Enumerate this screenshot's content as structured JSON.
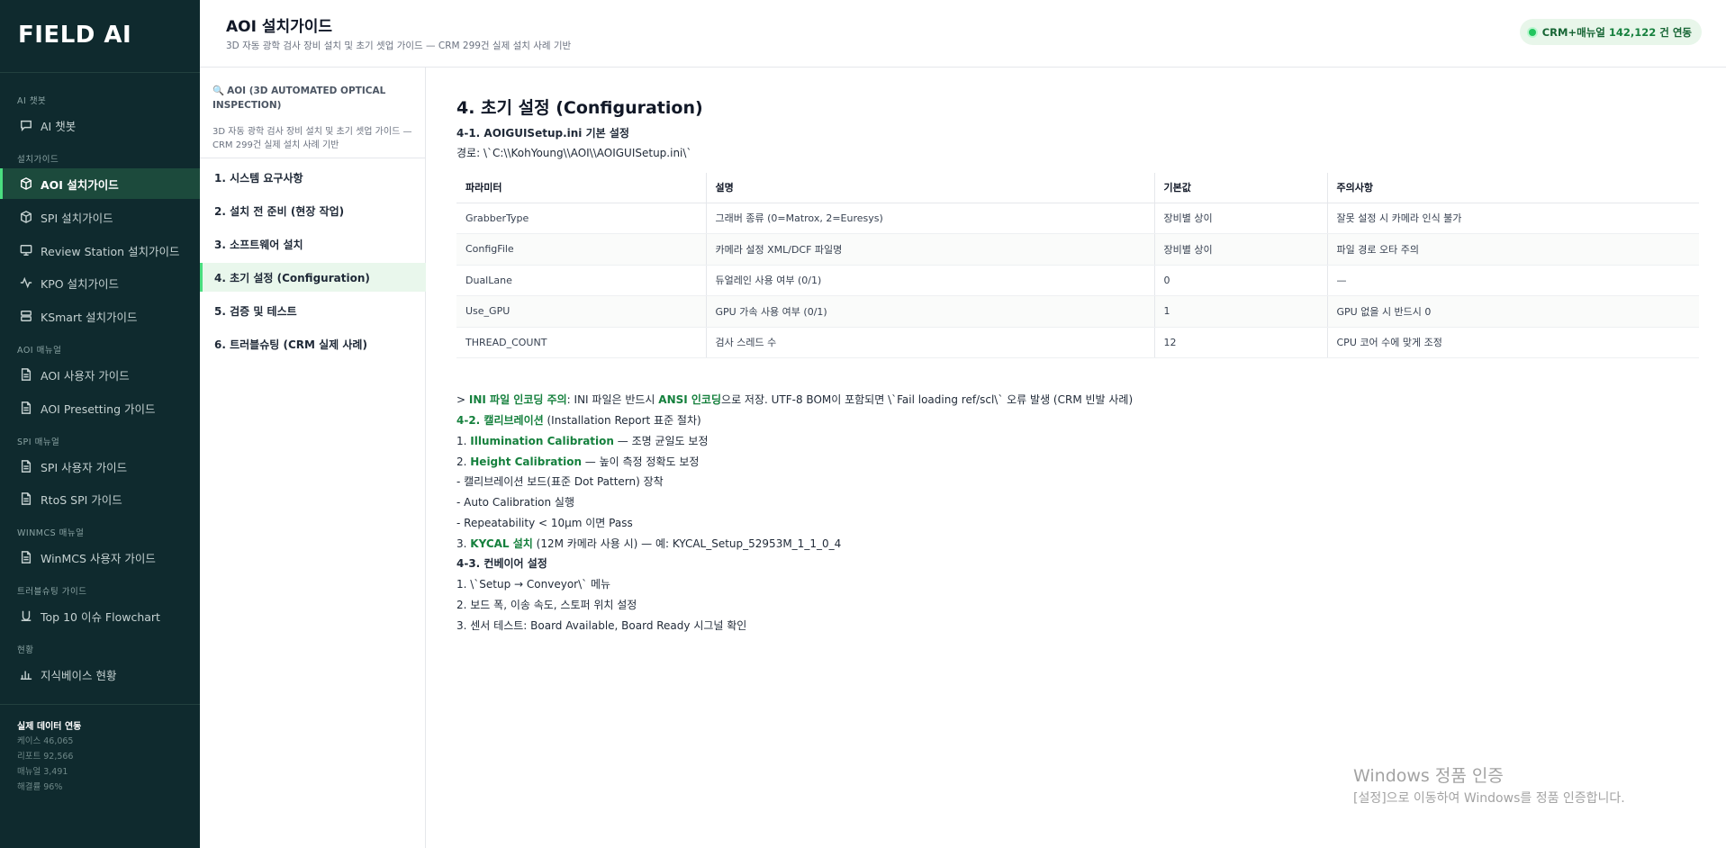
{
  "app": {
    "logo": "FIELD AI"
  },
  "sidebar": {
    "sections": [
      {
        "title": "AI 챗봇",
        "items": [
          {
            "label": "AI 챗봇",
            "icon": "chat-icon"
          }
        ]
      },
      {
        "title": "설치가이드",
        "items": [
          {
            "label": "AOI 설치가이드",
            "icon": "box-icon",
            "active": true
          },
          {
            "label": "SPI 설치가이드",
            "icon": "box-icon"
          },
          {
            "label": "Review Station 설치가이드",
            "icon": "monitor-icon"
          },
          {
            "label": "KPO 설치가이드",
            "icon": "pulse-icon"
          },
          {
            "label": "KSmart 설치가이드",
            "icon": "server-icon"
          }
        ]
      },
      {
        "title": "AOI 매뉴얼",
        "items": [
          {
            "label": "AOI 사용자 가이드",
            "icon": "document-icon"
          },
          {
            "label": "AOI Presetting 가이드",
            "icon": "document-icon"
          }
        ]
      },
      {
        "title": "SPI 매뉴얼",
        "items": [
          {
            "label": "SPI 사용자 가이드",
            "icon": "document-icon"
          },
          {
            "label": "RtoS SPI 가이드",
            "icon": "document-icon"
          }
        ]
      },
      {
        "title": "WINMCS 매뉴얼",
        "items": [
          {
            "label": "WinMCS 사용자 가이드",
            "icon": "document-icon"
          }
        ]
      },
      {
        "title": "트러블슈팅 가이드",
        "items": [
          {
            "label": "Top 10 이슈 Flowchart",
            "icon": "flow-icon"
          }
        ]
      },
      {
        "title": "현황",
        "items": [
          {
            "label": "지식베이스 현황",
            "icon": "bar-chart-icon"
          }
        ]
      }
    ],
    "footer": {
      "title": "실제 데이터 연동",
      "stats": [
        "케이스 46,065",
        "리포트 92,566",
        "매뉴얼 3,491",
        "해결률 96%"
      ]
    }
  },
  "header": {
    "title": "AOI 설치가이드",
    "subtitle": "3D 자동 광학 검사 장비 설치 및 초기 셋업 가이드 — CRM 299건 실제 설치 사례 기반",
    "sync": {
      "prefix": "CRM+매뉴얼",
      "count": "142,122",
      "suffix": "건 연동",
      "accent": "#22c55e"
    }
  },
  "guide": {
    "title": "AOI (3D AUTOMATED OPTICAL INSPECTION)",
    "description": "3D 자동 광학 검사 장비 설치 및 초기 셋업 가이드 — CRM 299건 실제 설치 사례 기반",
    "items": [
      "1. 시스템 요구사항",
      "2. 설치 전 준비 (현장 작업)",
      "3. 소프트웨어 설치",
      "4. 초기 설정 (Configuration)",
      "5. 검증 및 테스트",
      "6. 트러블슈팅 (CRM 실제 사례)"
    ],
    "active_index": 3
  },
  "content": {
    "title": "4. 초기 설정 (Configuration)",
    "s1_title": "4-1. AOIGUISetup.ini 기본 설정",
    "s1_path": "경로: \\`C:\\\\KohYoung\\\\AOI\\\\AOIGUISetup.ini\\`",
    "table": {
      "headers": [
        "파라미터",
        "설명",
        "기본값",
        "주의사항"
      ],
      "rows": [
        [
          "GrabberType",
          "그래버 종류 (0=Matrox, 2=Euresys)",
          "장비별 상이",
          "잘못 설정 시 카메라 인식 불가"
        ],
        [
          "ConfigFile",
          "카메라 설정 XML/DCF 파일명",
          "장비별 상이",
          "파일 경로 오타 주의"
        ],
        [
          "DualLane",
          "듀얼레인 사용 여부 (0/1)",
          "0",
          "—"
        ],
        [
          "Use_GPU",
          "GPU 가속 사용 여부 (0/1)",
          "1",
          "GPU 없을 시 반드시 0"
        ],
        [
          "THREAD_COUNT",
          "검사 스레드 수",
          "12",
          "CPU 코어 수에 맞게 조정"
        ]
      ]
    },
    "note": {
      "prefix": "> ",
      "label": "INI 파일 인코딩 주의",
      "text1": ": INI 파일은 반드시 ",
      "hl": "ANSI 인코딩",
      "text2": "으로 저장. UTF-8 BOM이 포함되면 \\`Fail loading ref/scl\\` 오류 발생 (CRM 빈발 사례)"
    },
    "s2": {
      "title": "4-2. 캘리브레이션",
      "title_rest": " (Installation Report 표준 절차)",
      "step1_num": "1. ",
      "step1_hl": "Illumination Calibration",
      "step1_rest": " — 조명 균일도 보정",
      "step2_num": "2. ",
      "step2_hl": "Height Calibration",
      "step2_rest": " — 높이 측정 정확도 보정",
      "sub1": "- 캘리브레이션 보드(표준 Dot Pattern) 장착",
      "sub2": "- Auto Calibration 실행",
      "sub3": "- Repeatability < 10μm 이면 Pass",
      "step3_num": "3. ",
      "step3_hl": "KYCAL 설치",
      "step3_rest": " (12M 카메라 사용 시) — 예: KYCAL_Setup_52953M_1_1_0_4"
    },
    "s3": {
      "title": "4-3. 컨베이어 설정",
      "l1": "1. \\`Setup → Conveyor\\` 메뉴",
      "l2": "2. 보드 폭, 이송 속도, 스토퍼 위치 설정",
      "l3": "3. 센서 테스트: Board Available, Board Ready 시그널 확인"
    }
  },
  "watermark": {
    "line1": "Windows 정품 인증",
    "line2": "[설정]으로 이동하여 Windows를 정품 인증합니다."
  },
  "colors": {
    "sidebar_bg": "#0f2a2e",
    "accent_green": "#15803d",
    "active_bg": "#1c4a3c"
  }
}
